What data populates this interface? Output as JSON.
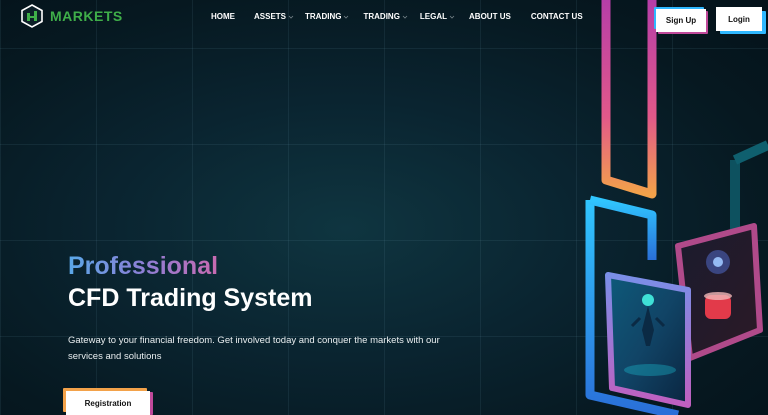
{
  "brand": {
    "name": "MARKETS",
    "accent": "#3fae49"
  },
  "nav": {
    "items": [
      {
        "label": "HOME",
        "dropdown": false
      },
      {
        "label": "ASSETS",
        "dropdown": true
      },
      {
        "label": "TRADING",
        "dropdown": true
      },
      {
        "label": "TRADING",
        "dropdown": true
      },
      {
        "label": "LEGAL",
        "dropdown": true
      },
      {
        "label": "ABOUT US",
        "dropdown": false
      },
      {
        "label": "CONTACT US",
        "dropdown": false
      }
    ]
  },
  "auth": {
    "signup_label": "Sign Up",
    "login_label": "Login"
  },
  "hero": {
    "title_highlight": "Professional",
    "title_main": "CFD Trading System",
    "subtitle": "Gateway to your financial freedom. Get involved today and conquer the markets with our services and solutions",
    "cta_label": "Registration"
  },
  "colors": {
    "background": "#082029",
    "gradient_start": "#5aa8e8",
    "gradient_end": "#c86ab0",
    "cyan": "#2fb8ff",
    "magenta": "#c0499a",
    "orange": "#f3a24a"
  }
}
